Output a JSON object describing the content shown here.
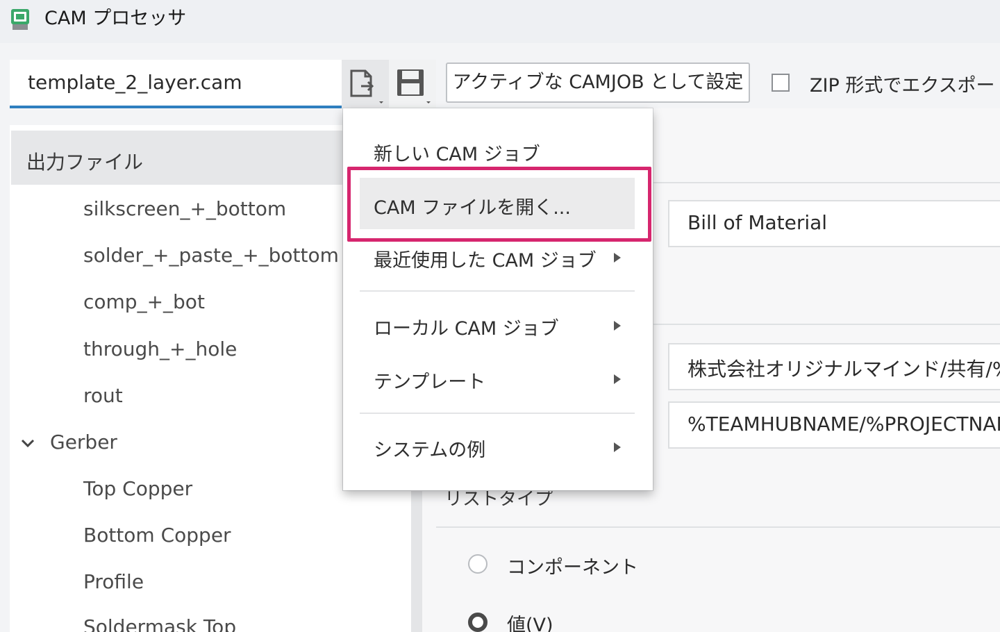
{
  "window": {
    "title": "CAM プロセッサ"
  },
  "toolbar": {
    "file_name": "template_2_layer.cam",
    "set_active_button": "アクティブな CAMJOB として設定",
    "zip_export_label": "ZIP 形式でエクスポート",
    "zip_export_checked": false
  },
  "tree": {
    "header": "出力ファイル",
    "items": [
      "silkscreen_+_bottom",
      "solder_+_paste_+_bottom",
      "comp_+_bot",
      "through_+_hole",
      "rout"
    ],
    "group": "Gerber",
    "group_items": [
      "Top Copper",
      "Bottom Copper",
      "Profile",
      "Soldermask Top"
    ]
  },
  "right": {
    "name_field": "Bill of Material",
    "path_field_1": "株式会社オリジナルマインド/共有/%ASSEMBLY",
    "path_field_2": "%TEAMHUBNAME/%PROJECTNAME",
    "list_type_label": "リストタイプ",
    "radio_component": "コンポーネント",
    "radio_value": "値(V)",
    "selected_radio": "値(V)"
  },
  "menu": {
    "items": [
      {
        "label": "新しい CAM ジョブ",
        "submenu": false
      },
      {
        "label": "CAM ファイルを開く...",
        "submenu": false,
        "highlighted": true
      },
      {
        "label": "最近使用した CAM ジョブ",
        "submenu": true
      },
      {
        "label": "ローカル CAM ジョブ",
        "submenu": true
      },
      {
        "label": "テンプレート",
        "submenu": true
      },
      {
        "label": "システムの例",
        "submenu": true
      }
    ]
  },
  "colors": {
    "accent": "#2f7fbf",
    "highlight": "#d6266e",
    "app_icon": "#3aa86a"
  },
  "icons": {
    "app": "cam-app-icon",
    "open_file": "open-file-icon",
    "save": "save-icon",
    "chevron": "chevron-down-icon",
    "submenu": "submenu-arrow-icon"
  }
}
